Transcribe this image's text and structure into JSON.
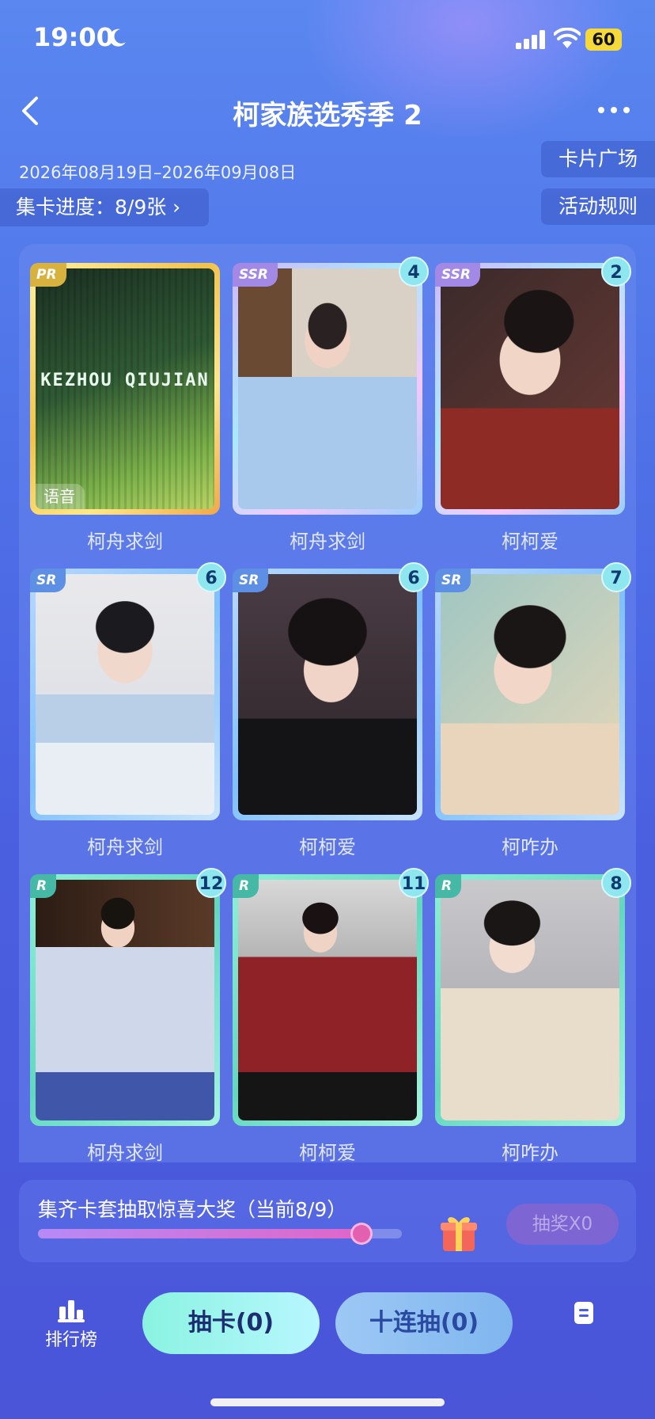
{
  "status_bar": {
    "time": "19:00",
    "battery": "60"
  },
  "header": {
    "title": "柯家族选秀季 2"
  },
  "event": {
    "dates": "2026年08月19日–2026年09月08日",
    "card_square_label": "卡片广场",
    "rules_label": "活动规则",
    "collect_progress": "集卡进度：8/9张 ›"
  },
  "cards": [
    {
      "rarity": "PR",
      "name": "柯舟求剑",
      "count": "",
      "badge": "语音",
      "logo": "KEZHOU QIUJIAN"
    },
    {
      "rarity": "SSR",
      "name": "柯舟求剑",
      "count": "4"
    },
    {
      "rarity": "SSR",
      "name": "柯柯爱",
      "count": "2"
    },
    {
      "rarity": "SR",
      "name": "柯舟求剑",
      "count": "6"
    },
    {
      "rarity": "SR",
      "name": "柯柯爱",
      "count": "6"
    },
    {
      "rarity": "SR",
      "name": "柯咋办",
      "count": "7"
    },
    {
      "rarity": "R",
      "name": "柯舟求剑",
      "count": "12"
    },
    {
      "rarity": "R",
      "name": "柯柯爱",
      "count": "11"
    },
    {
      "rarity": "R",
      "name": "柯咋办",
      "count": "8"
    }
  ],
  "prize": {
    "text": "集齐卡套抽取惊喜大奖（当前8/9）",
    "progress": 0.889,
    "lottery_label": "抽奖X0"
  },
  "bottom": {
    "rank_label": "排行榜",
    "draw_label": "抽卡(0)",
    "ten_draw_label": "十连抽(0)"
  }
}
